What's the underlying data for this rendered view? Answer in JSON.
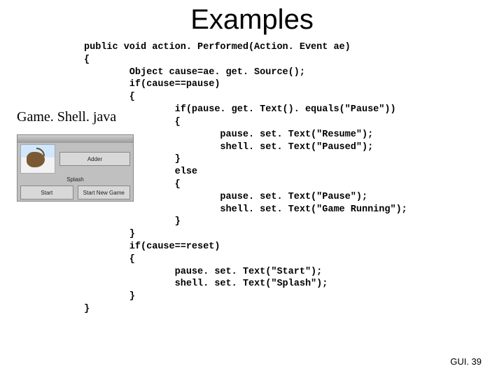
{
  "title": "Examples",
  "filename_label": "Game. Shell. java",
  "footer": "GUI. 39",
  "code": "public void action. Performed(Action. Event ae)\n{\n        Object cause=ae. get. Source();\n        if(cause==pause)\n        {\n                if(pause. get. Text(). equals(\"Pause\"))\n                {\n                        pause. set. Text(\"Resume\");\n                        shell. set. Text(\"Paused\");\n                }\n                else\n                {\n                        pause. set. Text(\"Pause\");\n                        shell. set. Text(\"Game Running\");\n                }\n        }\n        if(cause==reset)\n        {\n                pause. set. Text(\"Start\");\n                shell. set. Text(\"Splash\");\n        }\n}",
  "mockapp": {
    "adder_label": "Adder",
    "splash_label": "Splash",
    "btn_start": "Start",
    "btn_newgame": "Start New Game"
  }
}
